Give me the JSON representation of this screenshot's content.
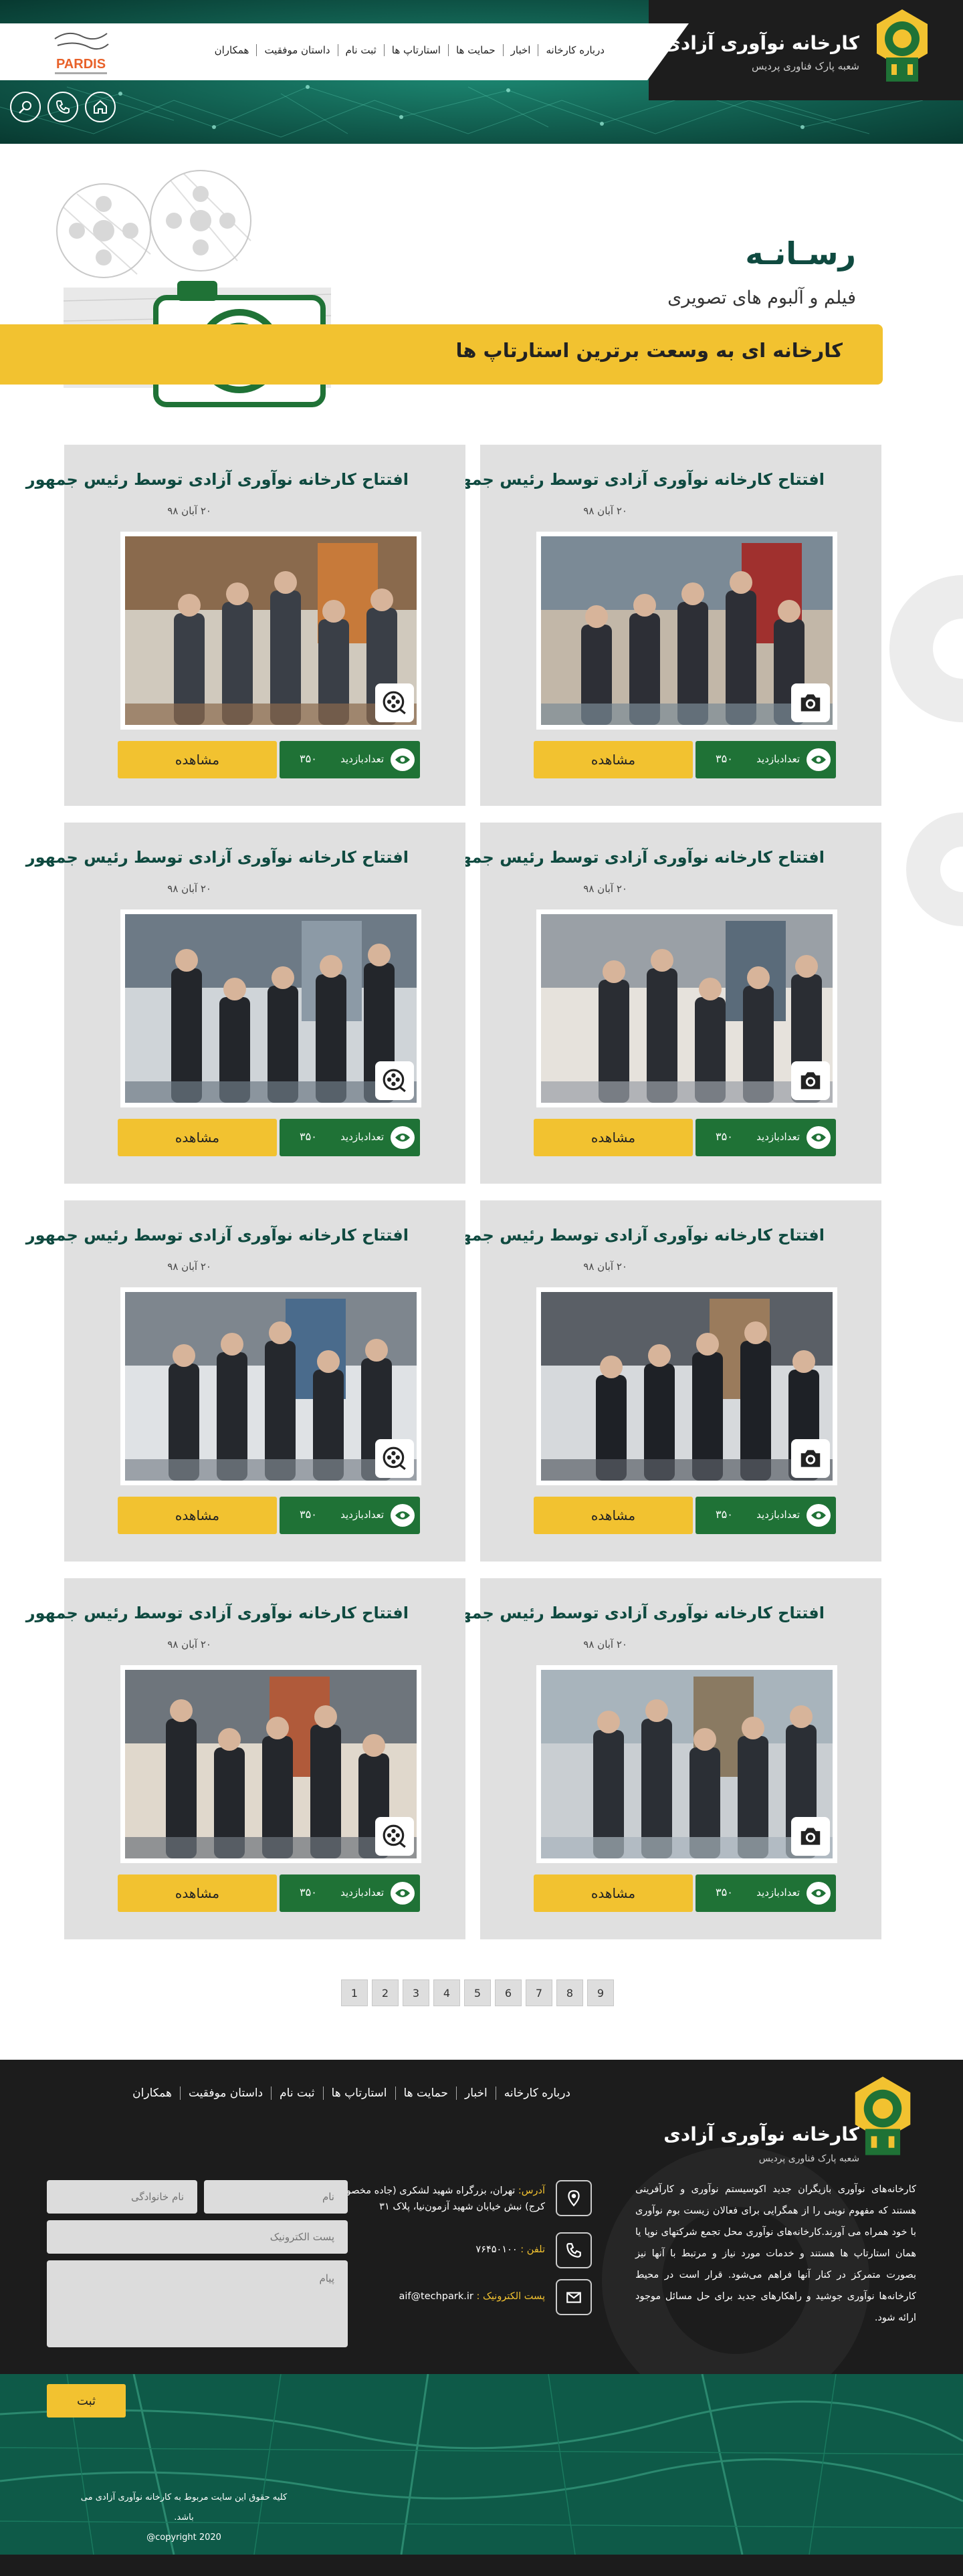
{
  "header": {
    "brand_title": "کارخانه نوآوری آزادی",
    "brand_sub": "شعبه پارک فناوری پردیس",
    "pardis_logo_text": "PARDIS",
    "nav": [
      "درباره کارخانه",
      "اخبار",
      "حمایت ها",
      "استارتاپ ها",
      "ثبت نام",
      "داستان موفقیت",
      "همکاران"
    ],
    "icons": [
      "home-icon",
      "phone-icon",
      "search-icon"
    ]
  },
  "hero": {
    "title": "رسـانـه",
    "subtitle": "فیلم و آلبوم های تصویری",
    "banner": "کارخانه ای به وسعت برترین استارتاپ ها"
  },
  "cards": [
    {
      "title": "افتتاح کارخانه نوآوری آزادی توسط رئیس جمهور",
      "date": "۲۰ آبان ۹۸",
      "media": "photo",
      "visits_label": "تعدادبازدید",
      "visits": "۳۵۰",
      "view_label": "مشاهده"
    },
    {
      "title": "افتتاح کارخانه نوآوری آزادی توسط رئیس جمهور",
      "date": "۲۰ آبان ۹۸",
      "media": "video",
      "visits_label": "تعدادبازدید",
      "visits": "۳۵۰",
      "view_label": "مشاهده"
    },
    {
      "title": "افتتاح کارخانه نوآوری آزادی توسط رئیس جمهور",
      "date": "۲۰ آبان ۹۸",
      "media": "photo",
      "visits_label": "تعدادبازدید",
      "visits": "۳۵۰",
      "view_label": "مشاهده"
    },
    {
      "title": "افتتاح کارخانه نوآوری آزادی توسط رئیس جمهور",
      "date": "۲۰ آبان ۹۸",
      "media": "video",
      "visits_label": "تعدادبازدید",
      "visits": "۳۵۰",
      "view_label": "مشاهده"
    },
    {
      "title": "افتتاح کارخانه نوآوری آزادی توسط رئیس جمهور",
      "date": "۲۰ آبان ۹۸",
      "media": "photo",
      "visits_label": "تعدادبازدید",
      "visits": "۳۵۰",
      "view_label": "مشاهده"
    },
    {
      "title": "افتتاح کارخانه نوآوری آزادی توسط رئیس جمهور",
      "date": "۲۰ آبان ۹۸",
      "media": "video",
      "visits_label": "تعدادبازدید",
      "visits": "۳۵۰",
      "view_label": "مشاهده"
    },
    {
      "title": "افتتاح کارخانه نوآوری آزادی توسط رئیس جمهور",
      "date": "۲۰ آبان ۹۸",
      "media": "photo",
      "visits_label": "تعدادبازدید",
      "visits": "۳۵۰",
      "view_label": "مشاهده"
    },
    {
      "title": "افتتاح کارخانه نوآوری آزادی توسط رئیس جمهور",
      "date": "۲۰ آبان ۹۸",
      "media": "video",
      "visits_label": "تعدادبازدید",
      "visits": "۳۵۰",
      "view_label": "مشاهده"
    }
  ],
  "pagination": [
    "1",
    "2",
    "3",
    "4",
    "5",
    "6",
    "7",
    "8",
    "9"
  ],
  "footer": {
    "nav": [
      "درباره کارخانه",
      "اخبار",
      "حمایت ها",
      "استارتاپ ها",
      "ثبت نام",
      "داستان موفقیت",
      "همکاران"
    ],
    "brand_title": "کارخانه نوآوری آزادی",
    "brand_sub": "شعبه پارک فناوری پردیس",
    "about": "کارخانه‌های نوآوری بازیگران جدید اکوسیستم نوآوری و کارآفرینی هستند که مفهوم نوینی را از همگرایی برای فعالان زیست بوم نوآوری با خود همراه می آورند.کارخانه‌های نوآوری محل تجمع شرکتهای نوپا یا همان استارتاپ ها هستند و خدمات مورد نیاز و مرتبط با آنها نیز بصورت متمرکز در کنار آنها فراهم می‌شود. قرار است در محیط کارخانه‌ها نوآوری جوشید و راهکارهای جدید برای حل مسائل موجود ارائه شود.",
    "address_key": "آدرس:",
    "address_val": "تهران، بزرگراه شهید لشکری (جاده مخصوص کرج) نبش خیابان شهید آزمون‌نیا، پلاک ۳۱",
    "phone_key": "تلفن :",
    "phone_val": "۷۶۴۵۰۱۰۰",
    "email_key": "پست الکترونیک :",
    "email_val": "aif@techpark.ir",
    "form": {
      "name": "نام",
      "family": "نام خانوادگی",
      "email": "پست الکترونیک",
      "message": "پیام",
      "submit": "ثبت"
    },
    "copyright_line1": "کلیه حقوق این سایت مربوط به کارخانه نوآوری آزادی می باشد.",
    "copyright_line2": "copyright 2020@"
  },
  "colors": {
    "green_dark": "#0f4a40",
    "green": "#1f7236",
    "yellow": "#f2c230",
    "footer": "#1c1c1c"
  }
}
